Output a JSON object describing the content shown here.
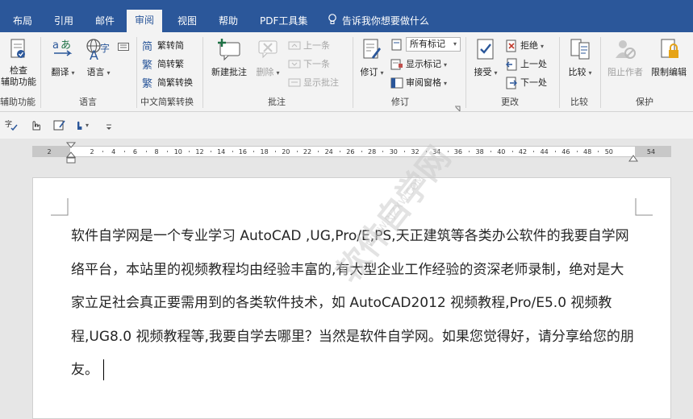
{
  "tabs": [
    {
      "label": "布局"
    },
    {
      "label": "引用"
    },
    {
      "label": "邮件"
    },
    {
      "label": "审阅"
    },
    {
      "label": "视图"
    },
    {
      "label": "帮助"
    },
    {
      "label": "PDF工具集"
    }
  ],
  "tell_me": "告诉我你想要做什么",
  "ribbon": {
    "accessibility": {
      "check_label": "检查\n辅助功能",
      "group": "辅助功能"
    },
    "language": {
      "translate": "翻译",
      "language": "语言",
      "group": "语言"
    },
    "chinese": {
      "to_simplified": "繁转简",
      "to_traditional": "简转繁",
      "convert": "简繁转换",
      "group": "中文简繁转换"
    },
    "comments": {
      "new": "新建批注",
      "delete": "删除",
      "previous": "上一条",
      "next": "下一条",
      "show": "显示批注",
      "group": "批注"
    },
    "tracking": {
      "track": "修订",
      "all_markup": "所有标记",
      "show_markup": "显示标记",
      "review_pane": "审阅窗格",
      "group": "修订"
    },
    "changes": {
      "accept": "接受",
      "reject": "拒绝",
      "previous": "上一处",
      "next": "下一处",
      "group": "更改"
    },
    "compare": {
      "compare": "比较",
      "group": "比较"
    },
    "protect": {
      "block_authors": "阻止作者",
      "restrict_editing": "限制编辑",
      "group": "保护"
    }
  },
  "ruler": {
    "labels": [
      "2",
      "2",
      "4",
      "6",
      "8",
      "10",
      "12",
      "14",
      "16",
      "18",
      "20",
      "22",
      "24",
      "26",
      "28",
      "30",
      "32",
      "34",
      "36",
      "38",
      "40",
      "42",
      "44",
      "46",
      "48",
      "50",
      "54"
    ]
  },
  "document": {
    "paragraph": "软件自学网是一个专业学习 AutoCAD ,UG,Pro/E,PS,天正建筑等各类办公软件的我要自学网络平台，本站里的视频教程均由经验丰富的,有大型企业工作经验的资深老师录制，绝对是大家立足社会真正要需用到的各类软件技术，如 AutoCAD2012 视频教程,Pro/E5.0 视频教程,UG8.0 视频教程等,我要自学去哪里？当然是软件自学网。如果您觉得好，请分享给您的朋友。"
  },
  "watermark": {
    "main": "软件自学网",
    "sub": "WWW.RJZXW.COM"
  },
  "colors": {
    "accent": "#2b579a",
    "ribbon": "#f3f3f3",
    "canvas": "#e6e6e6"
  }
}
